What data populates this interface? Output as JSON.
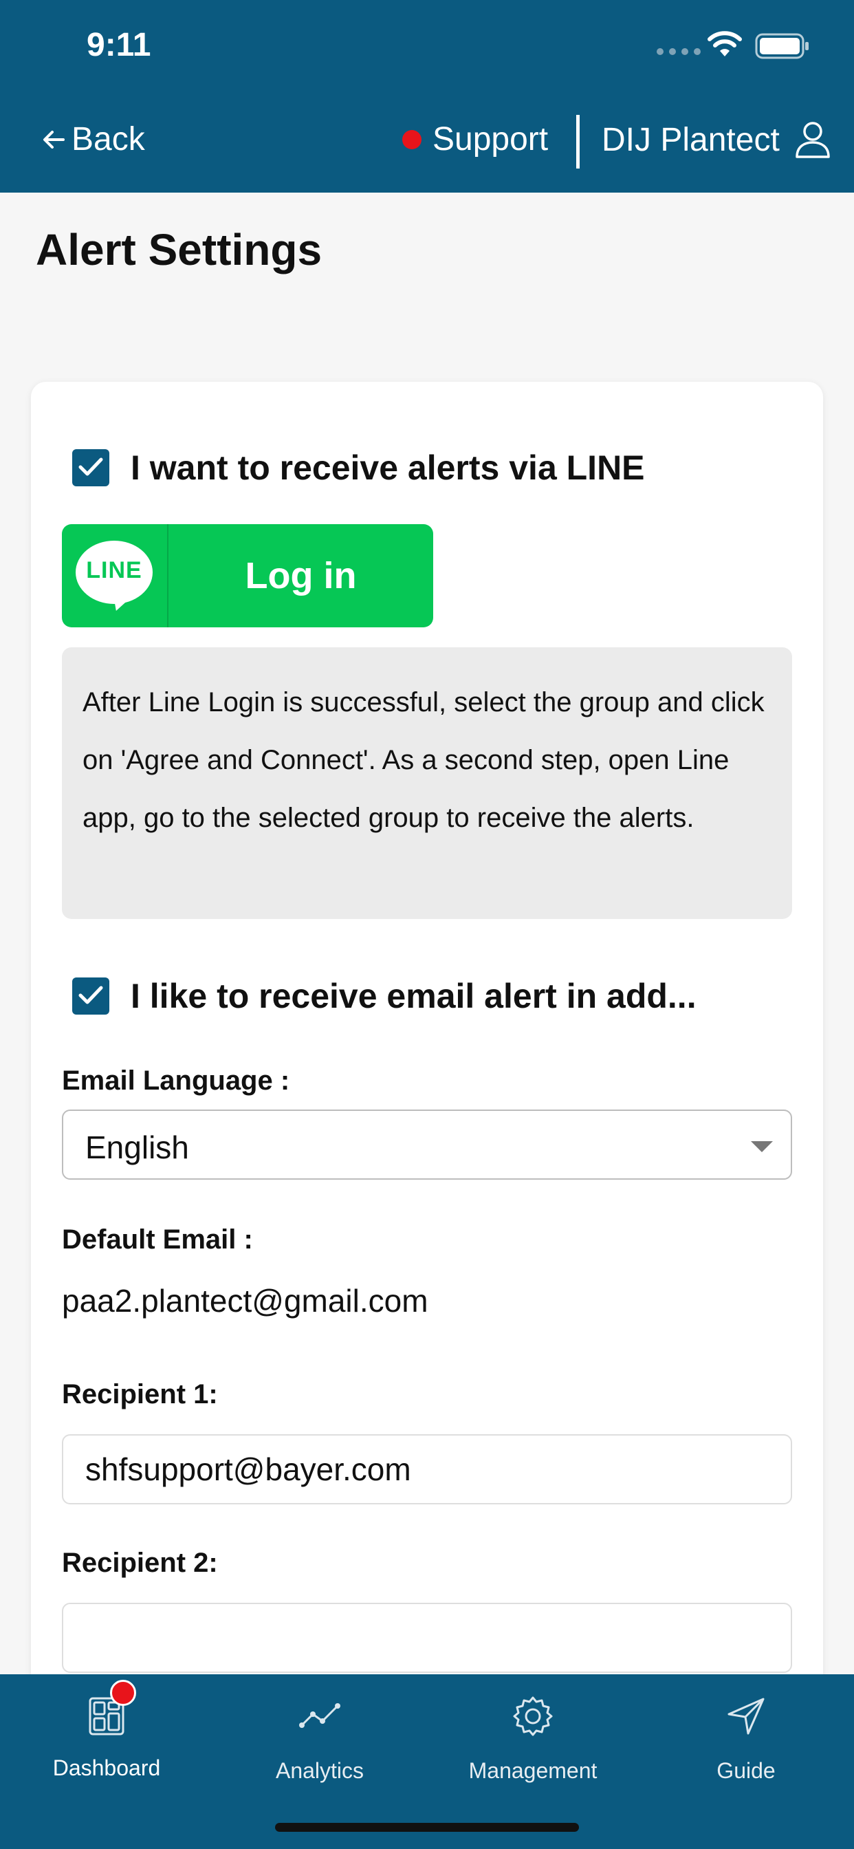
{
  "status_bar": {
    "time": "9:11"
  },
  "nav": {
    "back_label": "Back",
    "support_label": "Support",
    "account_label": "DIJ Plantect"
  },
  "page": {
    "title": "Alert Settings"
  },
  "line_alert": {
    "checkbox_label": "I want to receive alerts via LINE",
    "checked": true,
    "login_button_logo": "LINE",
    "login_button_label": "Log in",
    "info_text": "After Line Login is successful, select the group and click on 'Agree and Connect'. As a second step, open Line app, go to the selected group to receive the alerts."
  },
  "email_alert": {
    "checkbox_label": "I like to receive email alert in add...",
    "checked": true,
    "language_label": "Email Language :",
    "language_value": "English",
    "default_email_label": "Default Email :",
    "default_email_value": "paa2.plantect@gmail.com",
    "recipient1_label": "Recipient 1:",
    "recipient1_value": "shfsupport@bayer.com",
    "recipient2_label": "Recipient 2:",
    "recipient2_value": ""
  },
  "tab_bar": {
    "items": [
      {
        "label": "Dashboard",
        "icon": "dashboard-icon",
        "active": true
      },
      {
        "label": "Analytics",
        "icon": "analytics-icon",
        "active": false
      },
      {
        "label": "Management",
        "icon": "gear-icon",
        "active": false
      },
      {
        "label": "Guide",
        "icon": "navigation-arrow-icon",
        "active": false
      }
    ]
  },
  "colors": {
    "brand_blue": "#0b5a80",
    "line_green": "#06c755",
    "notification_red": "#e8141b"
  }
}
